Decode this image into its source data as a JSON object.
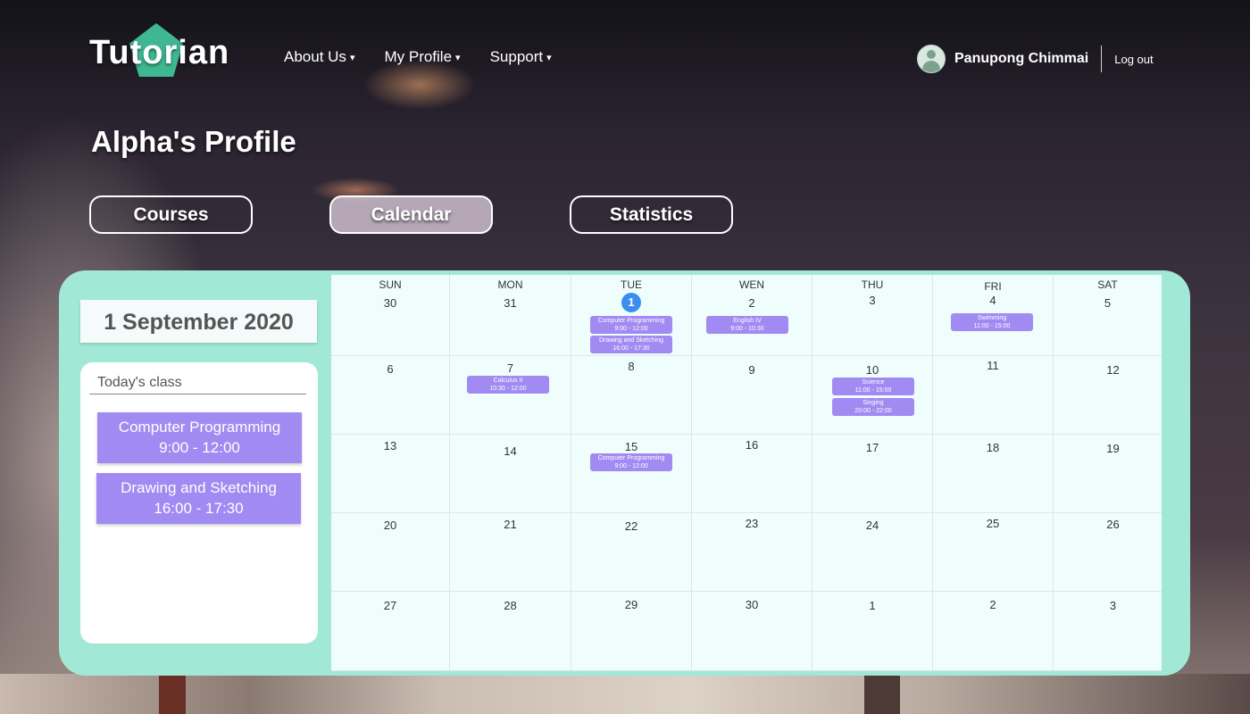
{
  "header": {
    "logo": "Tutorian",
    "nav": [
      {
        "label": "About Us",
        "caret": "▾"
      },
      {
        "label": "My Profile",
        "caret": "▾"
      },
      {
        "label": "Support",
        "caret": "▾"
      }
    ],
    "user_name": "Panupong Chimmai",
    "logout": "Log out"
  },
  "page_title": "Alpha's  Profile",
  "tabs": [
    {
      "label": "Courses",
      "active": false
    },
    {
      "label": "Calendar",
      "active": true
    },
    {
      "label": "Statistics",
      "active": false
    }
  ],
  "selected_date": "1 September 2020",
  "today_panel": {
    "title": "Today's  class",
    "classes": [
      {
        "name": "Computer  Programming",
        "time": "9:00  -  12:00"
      },
      {
        "name": "Drawing  and  Sketching",
        "time": "16:00  -  17:30"
      }
    ]
  },
  "calendar": {
    "weekdays": [
      "SUN",
      "MON",
      "TUE",
      "WEN",
      "THU",
      "FRI",
      "SAT"
    ],
    "weeks": [
      [
        "30",
        "31",
        "1",
        "2",
        "3",
        "4",
        "5"
      ],
      [
        "6",
        "7",
        "8",
        "9",
        "10",
        "11",
        "12"
      ],
      [
        "13",
        "14",
        "15",
        "16",
        "17",
        "18",
        "19"
      ],
      [
        "20",
        "21",
        "22",
        "23",
        "24",
        "25",
        "26"
      ],
      [
        "27",
        "28",
        "29",
        "30",
        "1",
        "2",
        "3"
      ]
    ],
    "today_cell": "1",
    "events": {
      "w0_tue_1": {
        "name": "Computer  Programming",
        "time": "9:00  -  12:00"
      },
      "w0_tue_2": {
        "name": "Drawing  and  Sketching",
        "time": "16:00  -  17:30"
      },
      "w0_wen_1": {
        "name": "English  IV",
        "time": "9:00  -  10:30"
      },
      "w0_fri_1": {
        "name": "Swimming",
        "time": "11:00  -  15:00"
      },
      "w1_mon_1": {
        "name": "Calculus  II",
        "time": "10:30  -  12:00"
      },
      "w1_thu_1": {
        "name": "Science",
        "time": "11:00  -  15:00"
      },
      "w1_thu_2": {
        "name": "Singing",
        "time": "20:00  -  22:00"
      },
      "w2_tue_1": {
        "name": "Computer  Programming",
        "time": "9:00  -  12:00"
      }
    }
  },
  "colors": {
    "panel": "#a2e8d6",
    "event": "#a18bf2",
    "today_marker": "#3a8ef0",
    "logo_accent": "#3fb892"
  }
}
